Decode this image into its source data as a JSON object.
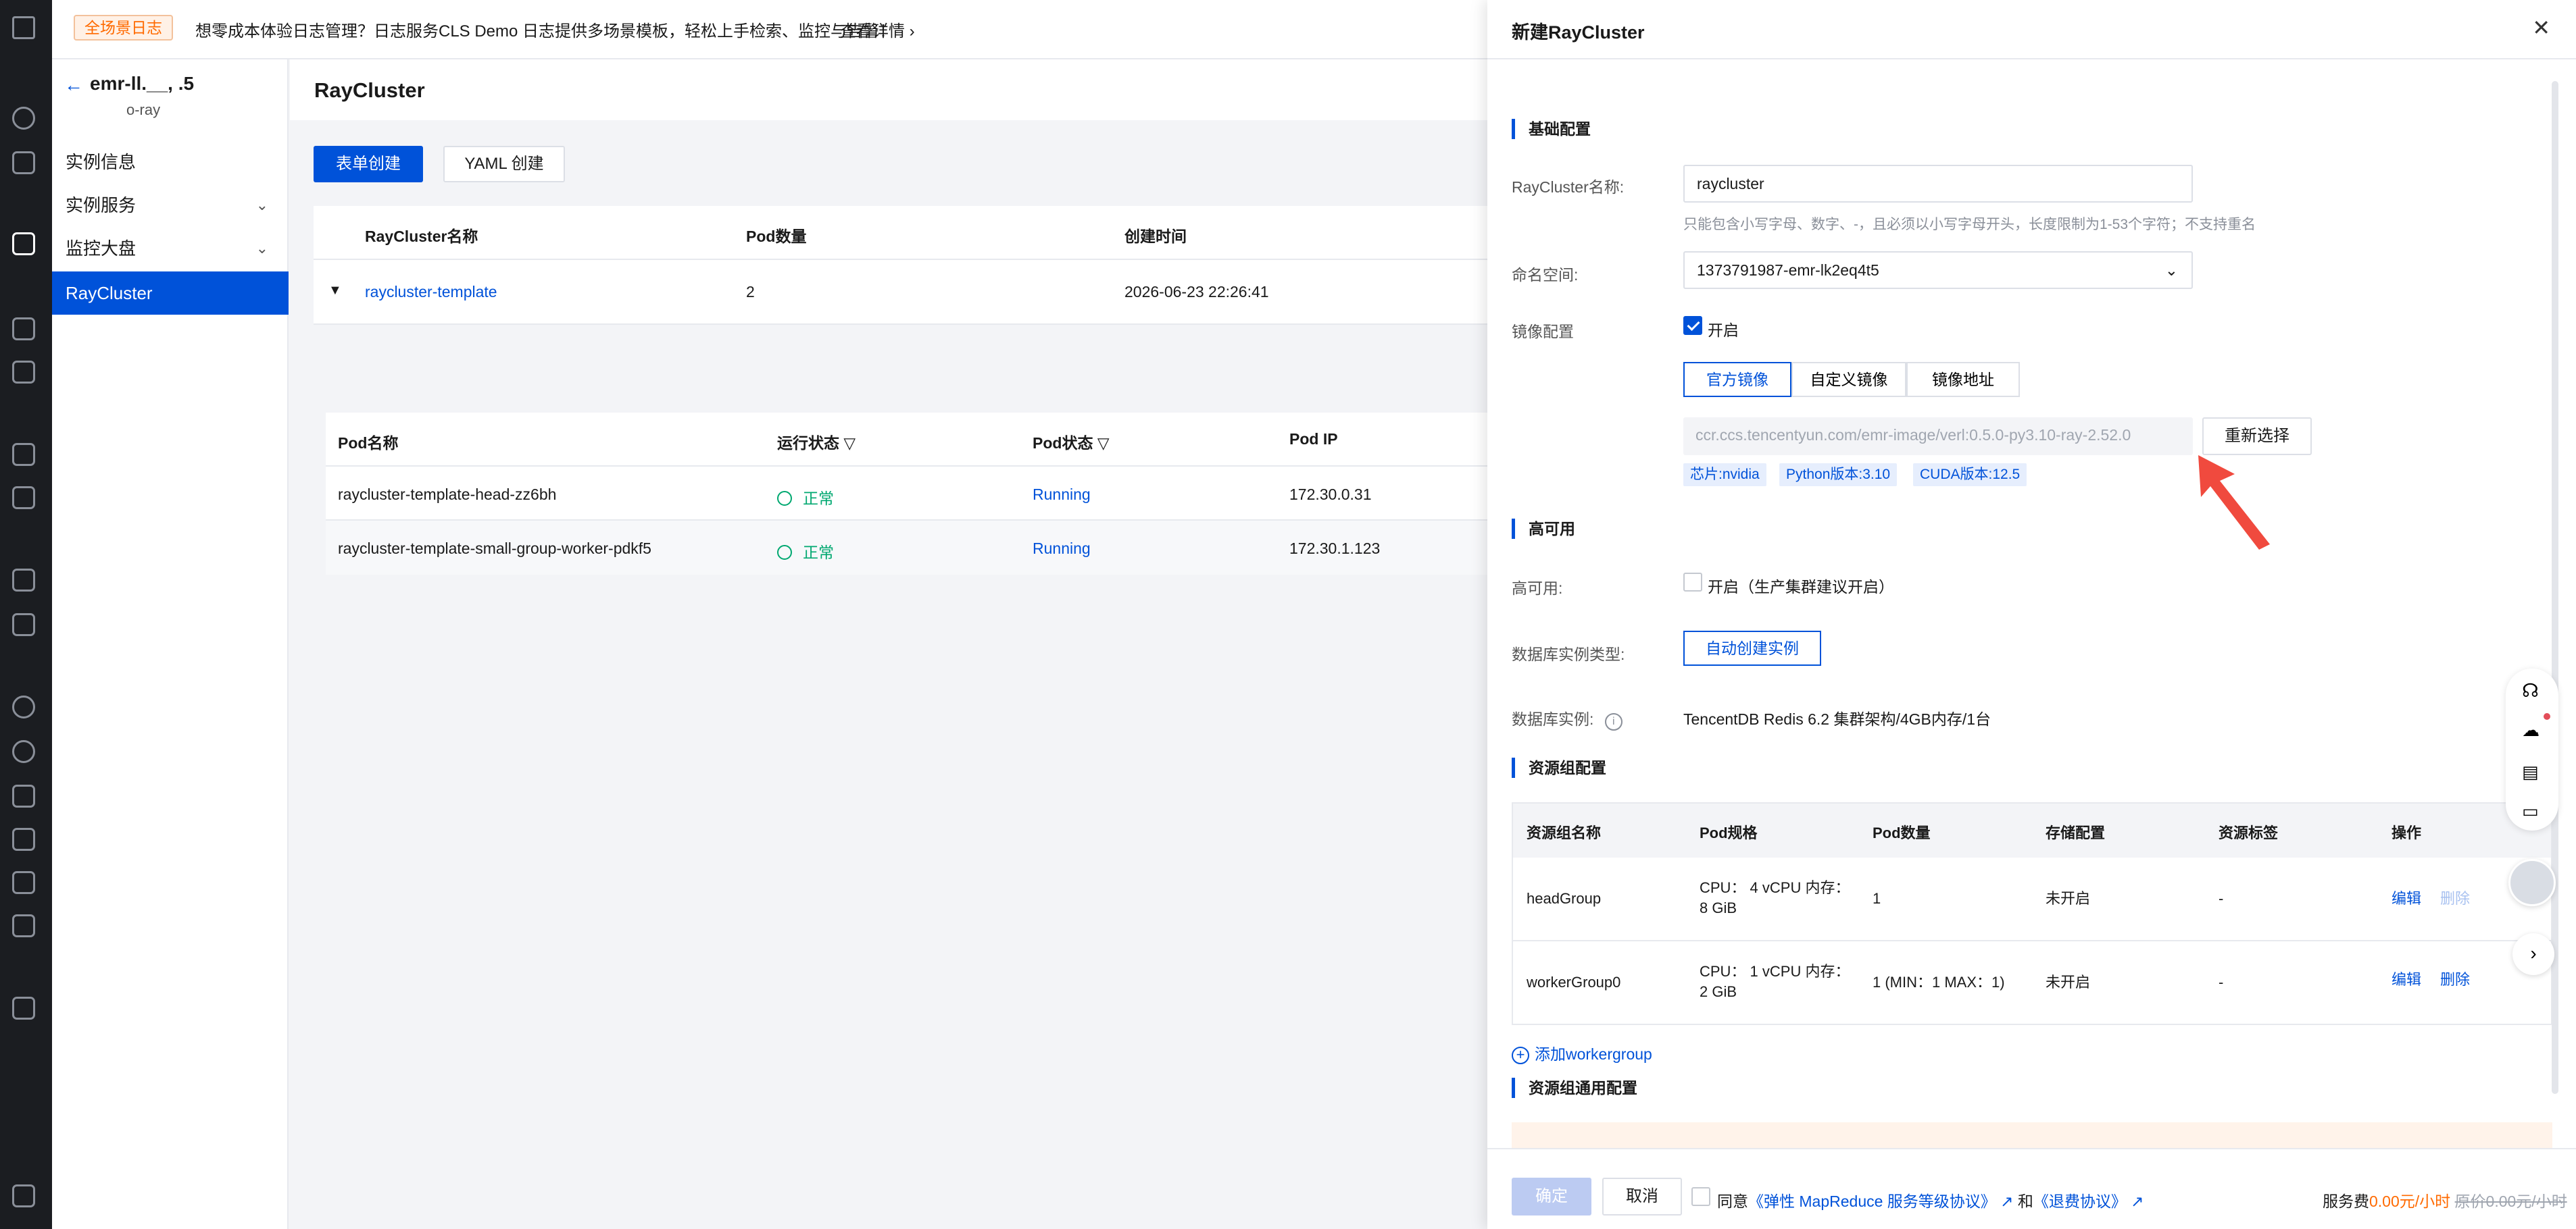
{
  "banner": {
    "badge": "全场景日志",
    "text": "想零成本体验日志管理？日志服务CLS Demo 日志提供多场景模板，轻松上手检索、监控与告警！",
    "link": "查看详情"
  },
  "sidebar": {
    "instance_title": "emr-ll.__, .5",
    "instance_sub": "o-ray",
    "items": [
      {
        "label": "实例信息"
      },
      {
        "label": "实例服务"
      },
      {
        "label": "监控大盘"
      },
      {
        "label": "RayCluster"
      }
    ]
  },
  "main": {
    "title": "RayCluster",
    "btn_form": "表单创建",
    "btn_yaml": "YAML 创建",
    "cluster_table": {
      "headers": [
        "RayCluster名称",
        "Pod数量",
        "创建时间"
      ],
      "rows": [
        {
          "name": "raycluster-template",
          "pods": "2",
          "created": "2026-06-23 22:26:41"
        }
      ]
    },
    "pod_table": {
      "headers": [
        "Pod名称",
        "运行状态",
        "Pod状态",
        "Pod IP"
      ],
      "rows": [
        {
          "name": "raycluster-template-head-zz6bh",
          "run": "正常",
          "status": "Running",
          "ip": "172.30.0.31"
        },
        {
          "name": "raycluster-template-small-group-worker-pdkf5",
          "run": "正常",
          "status": "Running",
          "ip": "172.30.1.123"
        }
      ]
    }
  },
  "drawer": {
    "title": "新建RayCluster",
    "section_basic": "基础配置",
    "name_label": "RayCluster名称:",
    "name_value": "raycluster",
    "name_hint": "只能包含小写字母、数字、-，且必须以小写字母开头，长度限制为1-53个字符；不支持重名",
    "ns_label": "命名空间:",
    "ns_value": "1373791987-emr-lk2eq4t5",
    "image_label": "镜像配置",
    "image_enable": "开启",
    "image_tabs": [
      "官方镜像",
      "自定义镜像",
      "镜像地址"
    ],
    "image_value": "ccr.ccs.tencentyun.com/emr-image/verl:0.5.0-py3.10-ray-2.52.0",
    "reselect": "重新选择",
    "tags": [
      "芯片:nvidia",
      "Python版本:3.10",
      "CUDA版本:12.5"
    ],
    "section_ha": "高可用",
    "ha_label": "高可用:",
    "ha_option": "开启（生产集群建议开启）",
    "db_type_label": "数据库实例类型:",
    "db_type_value": "自动创建实例",
    "db_label": "数据库实例:",
    "db_value": "TencentDB Redis 6.2 集群架构/4GB内存/1台",
    "section_rg": "资源组配置",
    "rg_headers": [
      "资源组名称",
      "Pod规格",
      "Pod数量",
      "存储配置",
      "资源标签",
      "操作"
    ],
    "rg_rows": [
      {
        "name": "headGroup",
        "spec1": "CPU： 4 vCPU 内存：",
        "spec2": "8 GiB",
        "count": "1",
        "storage": "未开启",
        "tag": "-",
        "edit": "编辑",
        "del": "删除"
      },
      {
        "name": "workerGroup0",
        "spec1": "CPU： 1 vCPU 内存：",
        "spec2": "2 GiB",
        "count": "1 (MIN：1 MAX：1)",
        "storage": "未开启",
        "tag": "-",
        "edit": "编辑",
        "del": "删除"
      }
    ],
    "add_wg": "添加workergroup",
    "section_common": "资源组通用配置",
    "footer": {
      "confirm": "确定",
      "cancel": "取消",
      "agree": "同意",
      "agreement1": "《弹性 MapReduce 服务等级协议》",
      "and": "和",
      "agreement2": "《退费协议》",
      "fee_label": "服务费",
      "fee_value": "0.00元/小时",
      "fee_orig": "原价0.00元/小时"
    }
  },
  "colors": {
    "primary": "#0052d9",
    "success": "#00a870",
    "warning": "#ff6a00",
    "rail": "#1b1d21"
  }
}
